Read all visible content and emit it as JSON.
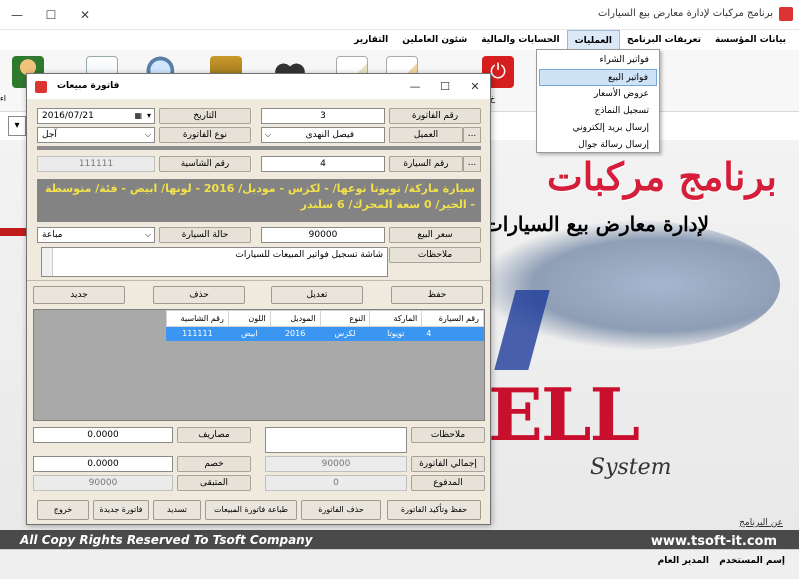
{
  "window": {
    "title": "برنامج مركبات لإدارة معارض بيع السيارات",
    "controls": [
      "—",
      "☐",
      "✕"
    ]
  },
  "menu": {
    "items": [
      "بيانات المؤسسة",
      "تعريفات البرنامج",
      "العمليات",
      "الحسابات والمالية",
      "شئون العاملين",
      "التقارير"
    ]
  },
  "dropdown": {
    "items": [
      "فواتير الشراء",
      "فواتير البيع",
      "عروض الأسعار",
      "تسجيل النماذج",
      "إرسال بريد إلكتروني",
      "إرسال رسالة جوال"
    ]
  },
  "toolbar": {
    "left_label": "اء",
    "right_label": "خ"
  },
  "filter_symbol": "▾",
  "banner": {
    "title": "برنامج مركبات",
    "subtitle": "لإدارة معارض بيع السيارات",
    "brand_part": "ELL",
    "brand_system": "System"
  },
  "footer": {
    "copyright": "All Copy Rights Reserved To Tsoft Company",
    "url": "www.tsoft-it.com",
    "about": "عن البرنامج",
    "user_label": "إسم المستخدم",
    "user_value": "المدير العام"
  },
  "dialog": {
    "title": "فاتورة مبيعات",
    "controls": [
      "—",
      "☐",
      "✕"
    ],
    "labels": {
      "invoice_no": "رقم الفاتورة",
      "date": "التاريخ",
      "customer": "العميل",
      "invoice_type": "نوع الفاتورة",
      "car_no": "رقم السيارة",
      "chassis_no": "رقم الشاسية",
      "sale_price": "سعر البيع",
      "car_status": "حالة السيارة",
      "notes": "ملاحظات",
      "expenses": "مصاريف",
      "discount": "خصم",
      "total_invoice": "إجمالي الفاتورة",
      "paid": "المدفوع",
      "remaining": "المتبقى",
      "bottom_notes": "ملاحظات"
    },
    "values": {
      "invoice_no": "3",
      "date": "2016/07/21",
      "customer": "فيصل النهدى",
      "invoice_type": "آجل",
      "car_no": "4",
      "chassis_no": "111111",
      "sale_price": "90000",
      "car_status": "مباعة",
      "notes": "شاشة تسجيل فواتير المبيعات للسيارات",
      "expenses": "0.0000",
      "discount": "0.0000",
      "total_invoice": "90000",
      "paid": "0",
      "remaining": "90000",
      "bottom_notes": ""
    },
    "description": "سيارة ماركة/ تويوتا نوعها/ - لكزس - موديل/ 2016 - لونها/ ابيض - فئة/ متوسطة - الحير/ 0 سعة المحرك/ 6 سلندر",
    "actions": {
      "save": "حفظ",
      "edit": "تعديل",
      "delete": "حذف",
      "new": "جديد"
    },
    "grid": {
      "headers": [
        "رقم السيارة",
        "الماركة",
        "النوع",
        "الموديل",
        "اللون",
        "رقم الشاسية"
      ],
      "rows": [
        [
          "4",
          "تويوتا",
          "لكزس",
          "2016",
          "ابيض",
          "111111"
        ]
      ]
    },
    "footer_buttons": {
      "save_confirm": "حفظ وتأكيد الفاتورة",
      "delete_invoice": "حذف الفاتورة",
      "print_sales": "طباعة فاتورة المبيعات",
      "pay": "تسديد",
      "new_invoice": "فاتورة جديدة",
      "exit": "خروج"
    },
    "dots_symbol": "...",
    "select_arrow": "⌵",
    "calendar_symbol": "▦"
  },
  "colors": {
    "brand_red": "#d41e3a",
    "selection_blue": "#3a96f1",
    "desc_text": "#f2e14a",
    "dialog_bg": "#f0e9dd"
  }
}
